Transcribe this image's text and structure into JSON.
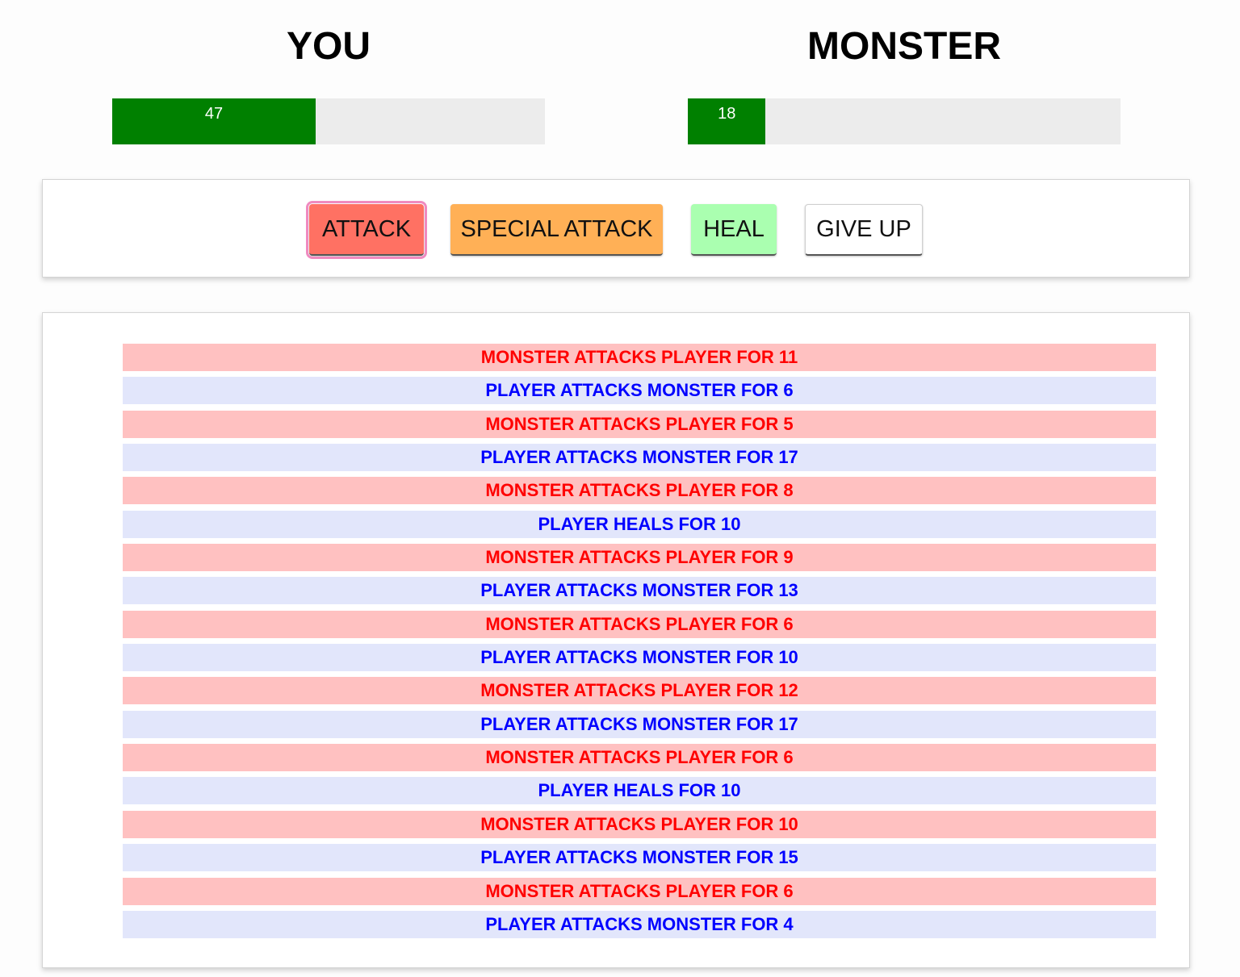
{
  "player": {
    "title": "YOU",
    "health": 47,
    "health_label": "47"
  },
  "monster": {
    "title": "MONSTER",
    "health": 18,
    "health_label": "18"
  },
  "colors": {
    "health_fill": "#008000",
    "health_track": "#ececec",
    "attack_button": "#ff7163",
    "special_attack_button": "#ffb056",
    "heal_button": "#aaffb0",
    "give_up_button": "#ffffff",
    "monster_log_bg": "#ffc1c1",
    "monster_log_text": "#ff0000",
    "player_log_bg": "#e2e6fb",
    "player_log_text": "#0000ff"
  },
  "controls": {
    "attack_label": "ATTACK",
    "special_attack_label": "SPECIAL ATTACK",
    "heal_label": "HEAL",
    "give_up_label": "GIVE UP"
  },
  "log": [
    {
      "actor": "monster",
      "text": "MONSTER ATTACKS PLAYER FOR 11"
    },
    {
      "actor": "player",
      "text": "PLAYER ATTACKS MONSTER FOR 6"
    },
    {
      "actor": "monster",
      "text": "MONSTER ATTACKS PLAYER FOR 5"
    },
    {
      "actor": "player",
      "text": "PLAYER ATTACKS MONSTER FOR 17"
    },
    {
      "actor": "monster",
      "text": "MONSTER ATTACKS PLAYER FOR 8"
    },
    {
      "actor": "player",
      "text": "PLAYER HEALS FOR 10"
    },
    {
      "actor": "monster",
      "text": "MONSTER ATTACKS PLAYER FOR 9"
    },
    {
      "actor": "player",
      "text": "PLAYER ATTACKS MONSTER FOR 13"
    },
    {
      "actor": "monster",
      "text": "MONSTER ATTACKS PLAYER FOR 6"
    },
    {
      "actor": "player",
      "text": "PLAYER ATTACKS MONSTER FOR 10"
    },
    {
      "actor": "monster",
      "text": "MONSTER ATTACKS PLAYER FOR 12"
    },
    {
      "actor": "player",
      "text": "PLAYER ATTACKS MONSTER FOR 17"
    },
    {
      "actor": "monster",
      "text": "MONSTER ATTACKS PLAYER FOR 6"
    },
    {
      "actor": "player",
      "text": "PLAYER HEALS FOR 10"
    },
    {
      "actor": "monster",
      "text": "MONSTER ATTACKS PLAYER FOR 10"
    },
    {
      "actor": "player",
      "text": "PLAYER ATTACKS MONSTER FOR 15"
    },
    {
      "actor": "monster",
      "text": "MONSTER ATTACKS PLAYER FOR 6"
    },
    {
      "actor": "player",
      "text": "PLAYER ATTACKS MONSTER FOR 4"
    }
  ]
}
